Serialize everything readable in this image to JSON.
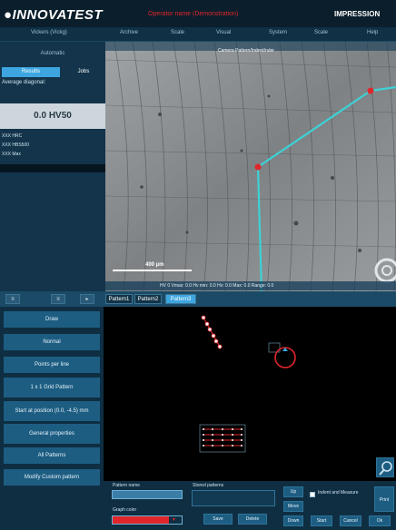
{
  "header": {
    "logo": "●INNOVATEST",
    "status": "Operator name  (Demonstration)",
    "brand": "IMPRESSION"
  },
  "menu": [
    "Vickers (Vickg)",
    "Archive",
    "Scale",
    "Visual",
    "System",
    "Scale",
    "Help"
  ],
  "left": {
    "automatic": "Automatic",
    "tab_results": "Results",
    "tab_jobs": "Jobs",
    "avg_label": "Average diagonal:",
    "hv_value": "0.0 HV50",
    "results": [
      "XXX HRC",
      "XXX HBS500",
      "XXX Max"
    ]
  },
  "image": {
    "caption": "Camera        Pattern/Indent/ruler",
    "scale": "400 µm",
    "footer": "HV 0   Vmax: 0.0   Hv min: 0.0   Hv: 0.0   Max: 0.0   Range: 0.0"
  },
  "toolbar": {
    "btns": [
      "≡",
      "≡",
      "▸"
    ],
    "tabs": [
      "Pattern1",
      "Pattern2",
      "Pattern3"
    ]
  },
  "buttons": [
    "Draw",
    "Normal",
    "Points per line",
    "1 x 1 Grid Pattern",
    "Start at position (0.0, -4.5) mm",
    "General properties",
    "All Patterns",
    "Modify Custom pattern"
  ],
  "bottom": {
    "pattern_name_label": "Pattern name",
    "pattern_name_value": "",
    "graph_color_label": "Graph color",
    "stored_label": "Stored patterns",
    "up": "Up",
    "move": "Move",
    "down": "Down",
    "indent_measure": "Indent and Measure",
    "save": "Save",
    "delete": "Delete",
    "start": "Start",
    "cancel": "Cancel",
    "ok": "Ok",
    "print": "Print",
    "graph_color": "#e0262b"
  }
}
